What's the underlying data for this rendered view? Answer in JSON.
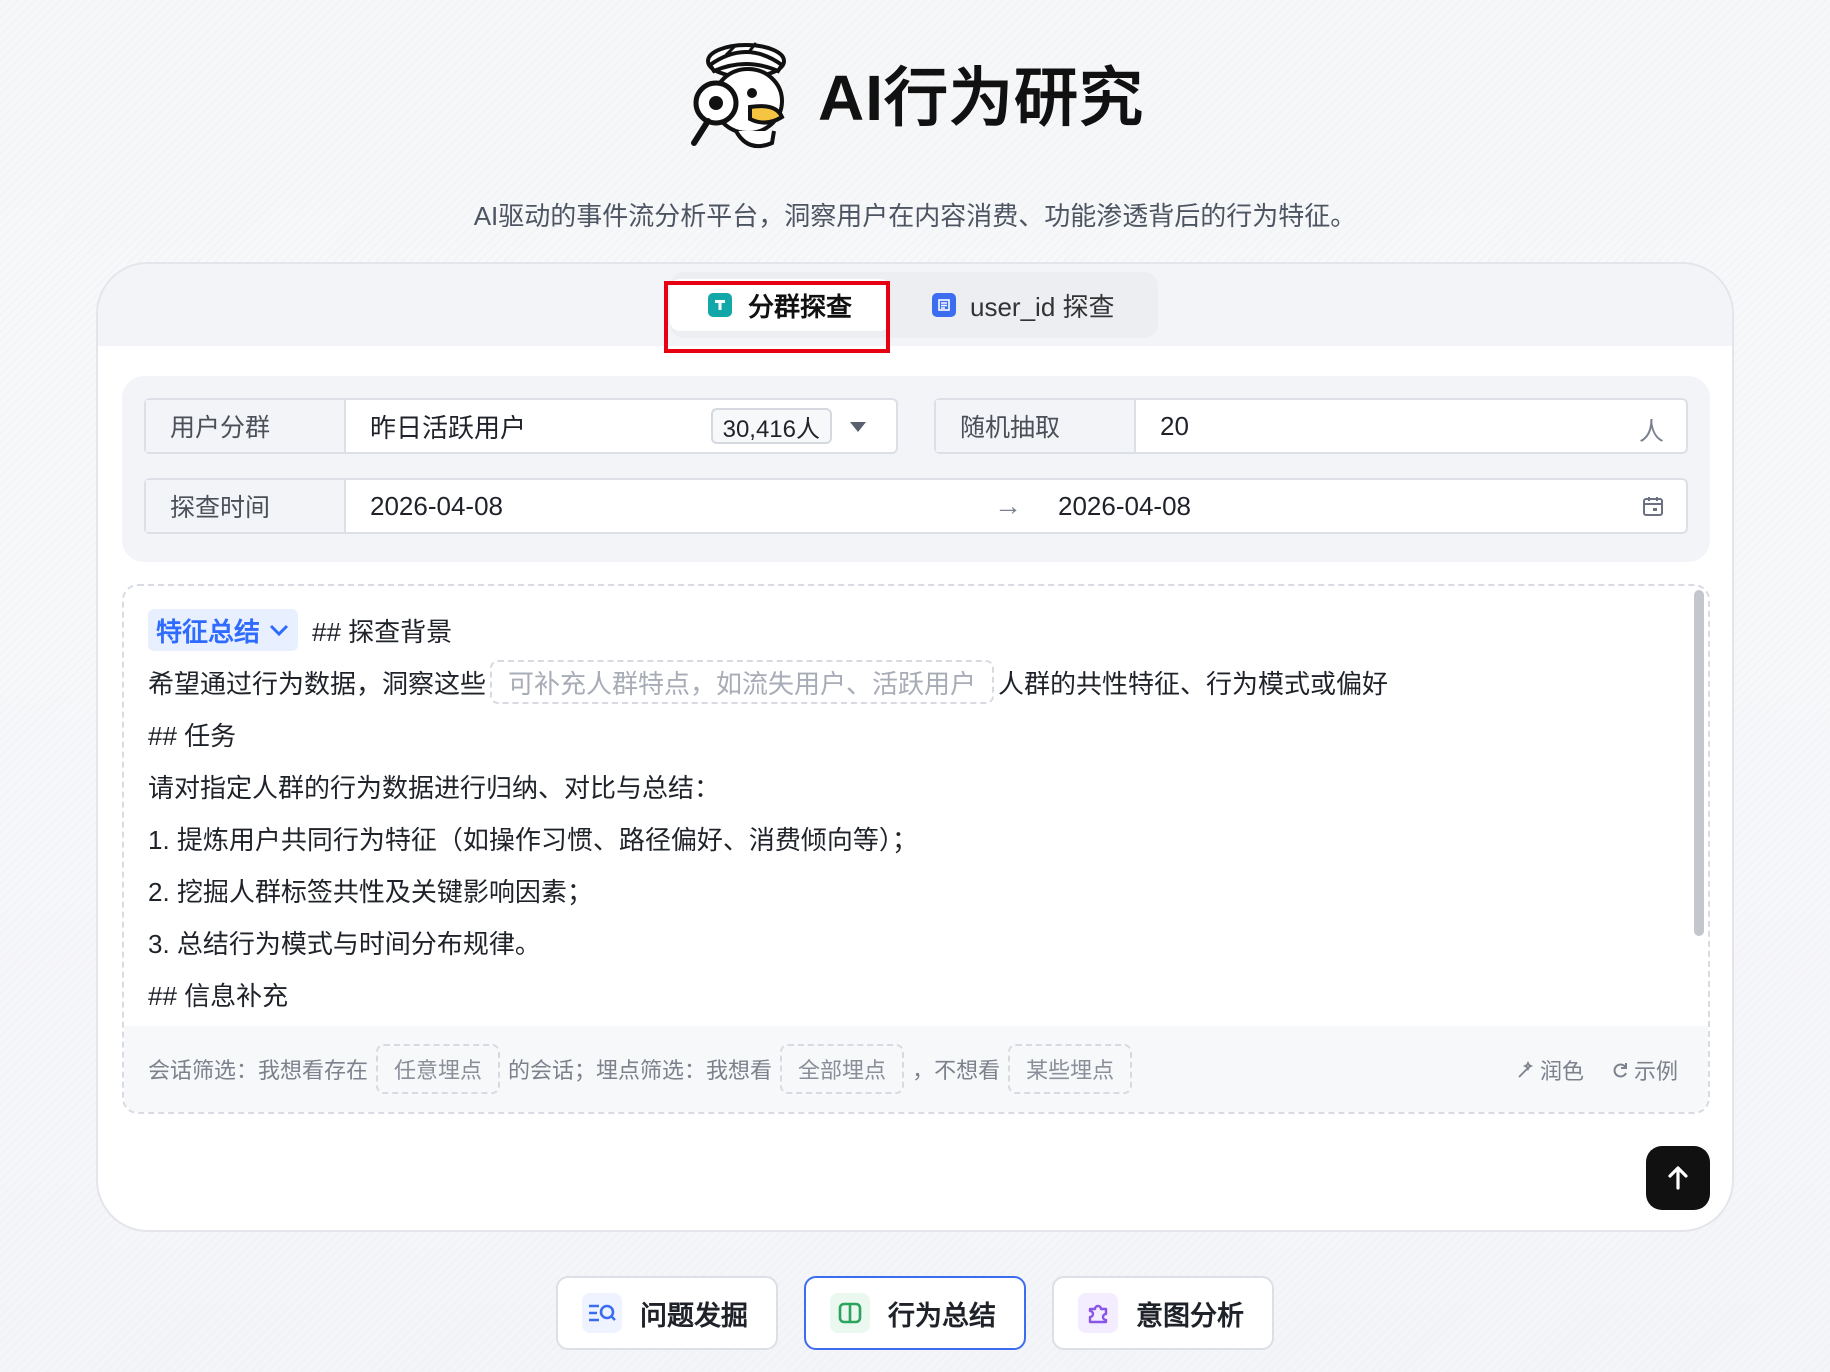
{
  "app": {
    "title": "AI行为研究",
    "subtitle": "AI驱动的事件流分析平台，洞察用户在内容消费、功能渗透背后的行为特征。"
  },
  "tabs": [
    {
      "label": "分群探查",
      "icon": "segment-icon",
      "active": true
    },
    {
      "label": "user_id 探查",
      "icon": "document-icon",
      "active": false
    }
  ],
  "form": {
    "segment_label": "用户分群",
    "segment_value": "昨日活跃用户",
    "segment_count": "30,416人",
    "sample_label": "随机抽取",
    "sample_value": "20",
    "sample_unit": "人",
    "time_label": "探查时间",
    "date_start": "2026-04-08",
    "date_arrow": "→",
    "date_end": "2026-04-08"
  },
  "editor": {
    "mode_chip": "特征总结",
    "line1": "## 探查背景",
    "line2_pre": "希望通过行为数据，洞察这些",
    "line2_placeholder": "可补充人群特点，如流失用户、活跃用户",
    "line2_post": "人群的共性特征、行为模式或偏好",
    "line3": "## 任务",
    "line4": "请对指定人群的行为数据进行归纳、对比与总结：",
    "line5": "1. 提炼用户共同行为特征（如操作习惯、路径偏好、消费倾向等）；",
    "line6": "2. 挖掘人群标签共性及关键影响因素；",
    "line7": "3. 总结行为模式与时间分布规律。",
    "line8": "## 信息补充"
  },
  "filters": {
    "session_prefix": "会话筛选：我想看存在",
    "session_value": "任意埋点",
    "session_suffix": "的会话；埋点筛选：我想看",
    "event_include": "全部埋点",
    "exclude_prefix": "，不想看",
    "event_exclude": "某些埋点",
    "polish_label": "润色",
    "example_label": "示例"
  },
  "modes": [
    {
      "label": "问题发掘",
      "icon": "search-list-icon",
      "active": false
    },
    {
      "label": "行为总结",
      "icon": "book-icon",
      "active": true
    },
    {
      "label": "意图分析",
      "icon": "puzzle-icon",
      "active": false
    }
  ]
}
